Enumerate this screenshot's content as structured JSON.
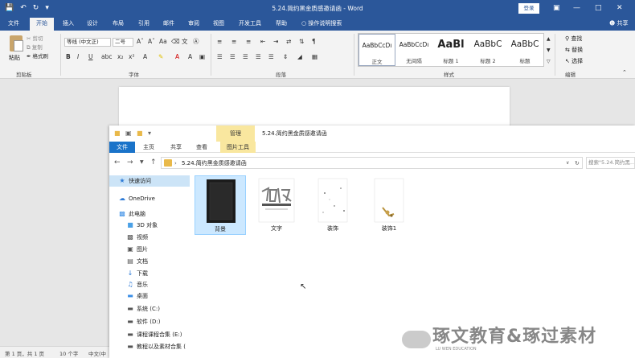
{
  "word": {
    "title": "5.24.简约黑金质感邀请函 - Word",
    "login_label": "登录",
    "tabs": [
      "文件",
      "开始",
      "插入",
      "设计",
      "布局",
      "引用",
      "邮件",
      "审阅",
      "视图",
      "开发工具",
      "帮助"
    ],
    "tell_me": "操作说明搜索",
    "share_label": "共享",
    "clipboard": {
      "paste_label": "粘贴",
      "cut_label": "剪切",
      "copy_label": "复制",
      "format_painter_label": "格式刷",
      "group_label": "剪贴板"
    },
    "font": {
      "name": "等线 (中文正)",
      "size": "二号",
      "group_label": "字体"
    },
    "paragraph": {
      "group_label": "段落"
    },
    "styles": {
      "group_label": "样式",
      "items": [
        {
          "sample": "AaBbCcDı",
          "name": "正文"
        },
        {
          "sample": "AaBbCcDı",
          "name": "无间隔"
        },
        {
          "sample": "AaBl",
          "name": "标题 1"
        },
        {
          "sample": "AaBbC",
          "name": "标题 2"
        },
        {
          "sample": "AaBbC",
          "name": "标题"
        }
      ]
    },
    "editing": {
      "group_label": "编辑",
      "find_label": "查找",
      "replace_label": "替换",
      "select_label": "选择"
    },
    "status": {
      "page": "第 1 页，共 1 页",
      "words": "10 个字",
      "language": "中文(中"
    },
    "accent_color": "#2b579a"
  },
  "explorer": {
    "manage_label": "管理",
    "title": "5.24.简约黑金质感邀请函",
    "tabs": [
      "文件",
      "主页",
      "共享",
      "查看",
      "图片工具"
    ],
    "path": "5.24.简约黑金质感邀请函",
    "search_placeholder": "搜索\"5.24.简约黑...",
    "nav": [
      {
        "icon": "star-icon",
        "label": "快速访问",
        "selected": true
      },
      {
        "icon": "cloud-icon",
        "label": "OneDrive"
      },
      {
        "icon": "computer-icon",
        "label": "此电脑"
      },
      {
        "icon": "cube-icon",
        "label": "3D 对象"
      },
      {
        "icon": "video-icon",
        "label": "视频"
      },
      {
        "icon": "picture-icon",
        "label": "图片"
      },
      {
        "icon": "document-icon",
        "label": "文档"
      },
      {
        "icon": "download-icon",
        "label": "下载"
      },
      {
        "icon": "music-icon",
        "label": "音乐"
      },
      {
        "icon": "desktop-icon",
        "label": "桌面"
      },
      {
        "icon": "drive-icon",
        "label": "系统 (C:)"
      },
      {
        "icon": "drive-icon",
        "label": "软件 (D:)"
      },
      {
        "icon": "drive-icon",
        "label": "课程课程合集 (E:)"
      },
      {
        "icon": "drive-icon",
        "label": "教程以及素材合集 ("
      }
    ],
    "files": [
      {
        "name": "背景",
        "selected": true
      },
      {
        "name": "文字"
      },
      {
        "name": "装饰"
      },
      {
        "name": "装饰1"
      }
    ]
  },
  "watermark": {
    "text": "琢文教育&琢过素材",
    "sub": "LU WEN EDUCATION"
  }
}
